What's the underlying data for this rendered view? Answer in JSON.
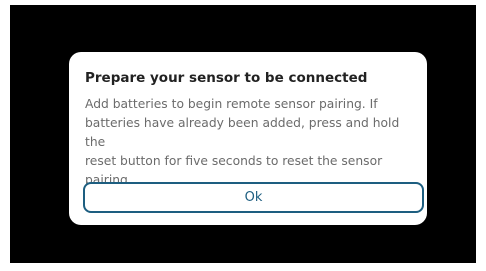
{
  "dialog": {
    "title": "Prepare your sensor to be connected",
    "message_lines": [
      "Add batteries to begin remote sensor pairing. If",
      "batteries have already been added, press and hold the",
      "reset button for five seconds to reset the sensor pairing."
    ],
    "ok_label": "Ok"
  },
  "colors": {
    "backdrop": "#000000",
    "dialog_background": "#ffffff",
    "accent": "#1d5e80",
    "title_text": "#222222",
    "body_text": "#6b6b6b"
  }
}
